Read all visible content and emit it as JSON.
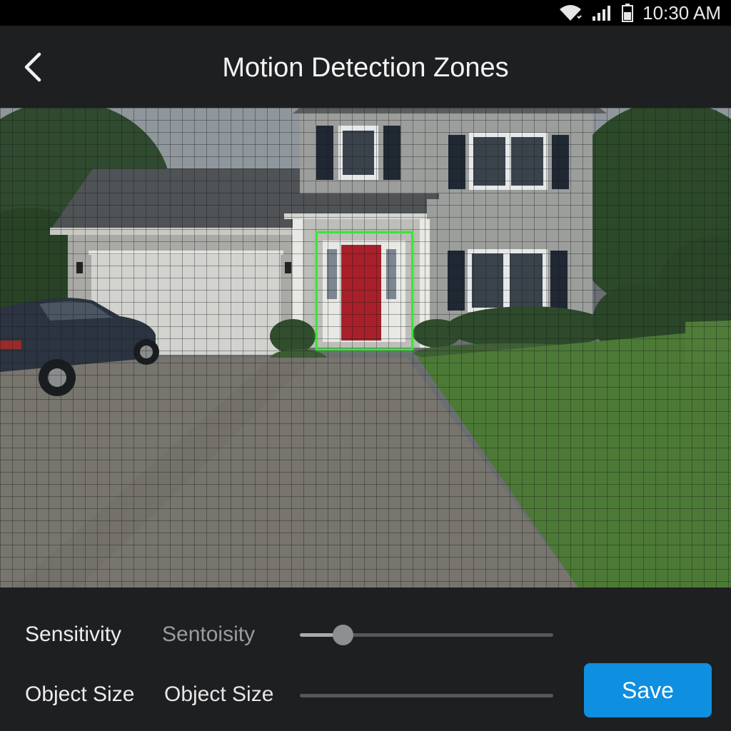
{
  "status_bar": {
    "time": "10:30 AM",
    "icons": [
      "wifi-icon",
      "signal-icon",
      "battery-icon"
    ]
  },
  "header": {
    "back_icon": "chevron-left-icon",
    "title": "Motion Detection Zones"
  },
  "camera": {
    "scene": "front-house-camera-feed",
    "grid_overlay": true,
    "zone_color": "#3fe23a"
  },
  "controls": {
    "sensitivity": {
      "label": "Sensitivity",
      "sublabel": "Sentoisity",
      "value_fraction": 0.17
    },
    "object_size": {
      "label": "Object Size",
      "sublabel": "Object Size",
      "value_fraction": 0
    },
    "save_label": "Save"
  },
  "colors": {
    "accent": "#0f8fe0",
    "background": "#1e1f21",
    "zone": "#3fe23a"
  }
}
